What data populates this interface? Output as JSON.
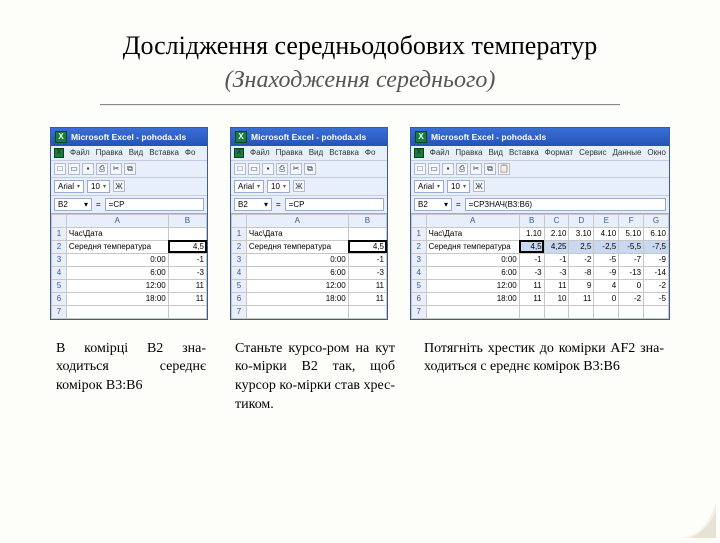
{
  "title": "Дослідження середньодобових температур",
  "subtitle": "(Знаходження середнього)",
  "excel_title": "Microsoft Excel - pohoda.xls",
  "menus_short": [
    "Файл",
    "Правка",
    "Вид",
    "Вставка",
    "Фо"
  ],
  "menus_long": [
    "Файл",
    "Правка",
    "Вид",
    "Вставка",
    "Формат",
    "Сервис",
    "Данные",
    "Окно"
  ],
  "font_name": "Arial",
  "font_size": "10",
  "namebox": "B2",
  "fx_short": "=СР",
  "fx_long": "=СРЗНАЧ(B3:B6)",
  "col_headers_small": [
    "A",
    "B"
  ],
  "col_headers_wide": [
    "A",
    "B",
    "C",
    "D",
    "E",
    "F",
    "G"
  ],
  "row_headers": [
    "1",
    "2",
    "3",
    "4",
    "5",
    "6",
    "7"
  ],
  "labels": {
    "r1": "Час\\Дата",
    "r2": "Середня температура",
    "t3": "0:00",
    "t4": "6:00",
    "t5": "12:00",
    "t6": "18:00"
  },
  "grid_small": {
    "b2": "4,5",
    "b3": "-1",
    "b4": "-3",
    "b5": "11",
    "b6": "11"
  },
  "wide_b2_row": [
    "4,5",
    "4,25",
    "2,5",
    "-2,5",
    "-5,5",
    "-7,5"
  ],
  "wide_rows": {
    "r1": [
      "1.10",
      "2.10",
      "3.10",
      "4.10",
      "5.10",
      "6.10"
    ],
    "r3": [
      "-1",
      "-1",
      "-2",
      "-5",
      "-7",
      "-9"
    ],
    "r4": [
      "-3",
      "-3",
      "-8",
      "-9",
      "-13",
      "-14"
    ],
    "r5": [
      "11",
      "11",
      "9",
      "4",
      "0",
      "-2"
    ],
    "r6": [
      "11",
      "10",
      "11",
      "0",
      "-2",
      "-5"
    ]
  },
  "captions": {
    "c1": "В комірці В2 зна-ходиться середнє комірок В3:В6",
    "c2": "Станьте курсо-ром на кут ко-мірки В2 так, щоб курсор ко-мірки став хрес-тиком.",
    "c3": "Потягніть хрестик до комірки AF2 зна-ходиться с ереднє комірок В3:В6"
  },
  "icons": {
    "excel_logo": "X",
    "new": "□",
    "open": "▭",
    "save": "▪",
    "print": "⎙",
    "cut": "✂",
    "copy": "⧉",
    "paste": "📋",
    "bold": "Ж",
    "dropdown": "▾",
    "fx": "="
  }
}
